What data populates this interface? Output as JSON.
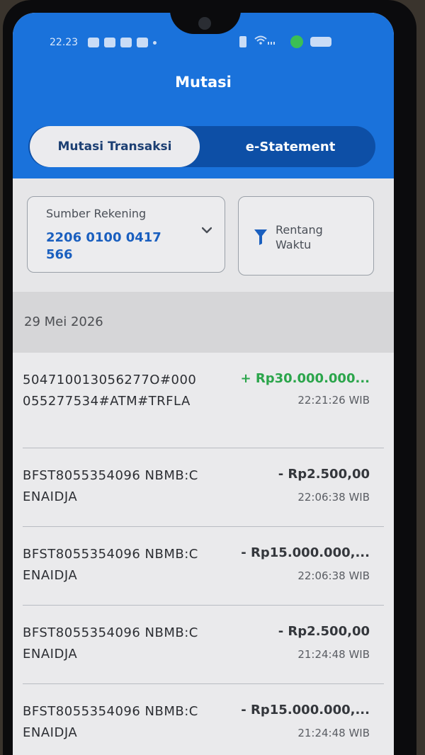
{
  "status_bar": {
    "time": "22.23",
    "notification_icons": [
      "notif-icon",
      "notif-icon",
      "notif-icon",
      "notif-icon",
      "dot-icon"
    ],
    "right_icons": [
      "vibrate-icon",
      "wifi-icon",
      "signal-icon",
      "app-indicator-icon",
      "battery-icon"
    ],
    "wifi_text": "ᯤ ...",
    "accent": "#3bbf55"
  },
  "header": {
    "title": "Mutasi",
    "background": "#1a72db"
  },
  "tabs": [
    {
      "label": "Mutasi Transaksi",
      "active": true
    },
    {
      "label": "e-Statement",
      "active": false
    }
  ],
  "filters": {
    "source_label": "Sumber Rekening",
    "source_account": "2206 0100 0417 566",
    "range_label": "Rentang Waktu",
    "funnel_icon": "filter-icon",
    "chevron_icon": "chevron-down-icon"
  },
  "date_group": "29 Mei 2026",
  "transactions": [
    {
      "description": "504710013056277O#000055277534#ATM#TRFLA",
      "amount": "+ Rp30.000.000...",
      "time": "22:21:26 WIB",
      "type": "credit"
    },
    {
      "description": "BFST8055354096 NBMB:CENAIDJA",
      "amount": "- Rp2.500,00",
      "time": "22:06:38 WIB",
      "type": "debit"
    },
    {
      "description": "BFST8055354096 NBMB:CENAIDJA",
      "amount": "- Rp15.000.000,...",
      "time": "22:06:38 WIB",
      "type": "debit"
    },
    {
      "description": "BFST8055354096 NBMB:CENAIDJA",
      "amount": "- Rp2.500,00",
      "time": "21:24:48 WIB",
      "type": "debit"
    },
    {
      "description": "BFST8055354096 NBMB:CENAIDJA",
      "amount": "- Rp15.000.000,...",
      "time": "21:24:48 WIB",
      "type": "debit"
    }
  ]
}
